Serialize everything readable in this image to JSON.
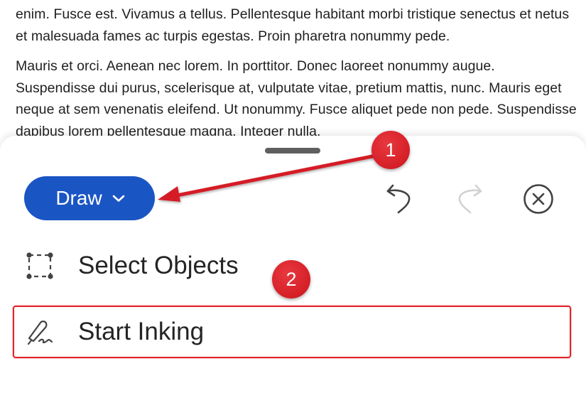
{
  "document": {
    "paragraphs": [
      "enim. Fusce est. Vivamus a tellus. Pellentesque habitant morbi tristique senectus et netus et malesuada fames ac turpis egestas. Proin pharetra nonummy pede.",
      "Mauris et orci. Aenean nec lorem. In porttitor. Donec laoreet nonummy augue. Suspendisse dui purus, scelerisque at, vulputate vitae, pretium mattis, nunc. Mauris eget neque at sem venenatis eleifend. Ut nonummy. Fusce aliquet pede non pede. Suspendisse dapibus lorem pellentesque magna. Integer nulla."
    ]
  },
  "toolbar": {
    "mode_label": "Draw",
    "mode_chevron_icon": "chevron-down-icon",
    "undo_icon": "undo-icon",
    "redo_icon": "redo-icon",
    "close_icon": "close-circle-icon"
  },
  "menu": {
    "items": [
      {
        "label": "Select Objects",
        "icon": "select-objects-icon"
      },
      {
        "label": "Start Inking",
        "icon": "pen-ink-icon"
      }
    ]
  },
  "annotations": {
    "badge_1": "1",
    "badge_2": "2",
    "color": "#d51f27"
  },
  "colors": {
    "accent": "#1a55c4",
    "highlight": "#e0242b"
  }
}
